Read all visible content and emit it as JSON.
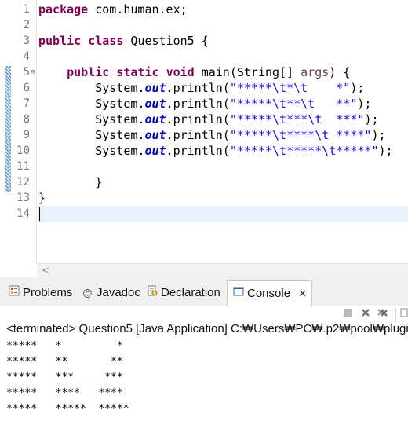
{
  "editor": {
    "line_numbers": [
      "1",
      "2",
      "3",
      "4",
      "5",
      "6",
      "7",
      "8",
      "9",
      "10",
      "11",
      "12",
      "13",
      "14"
    ],
    "fold_marker": "⊖",
    "code": {
      "l1_kw": "package",
      "l1_rest": " com.human.ex;",
      "l3_kw1": "public",
      "l3_kw2": "class",
      "l3_rest": " Question5 {",
      "l5_indent": "    ",
      "l5_kw1": "public",
      "l5_kw2": "static",
      "l5_kw3": "void",
      "l5_mid": " main(String[] ",
      "l5_arg": "args",
      "l5_end": ") {",
      "sys_indent": "        System.",
      "sys_field": "out",
      "sys_call": ".println(",
      "str6": "\"*****\\t*\\t    *\"",
      "str7": "\"*****\\t**\\t   **\"",
      "str8": "\"*****\\t***\\t  ***\"",
      "str9": "\"*****\\t****\\t ****\"",
      "str10": "\"*****\\t*****\\t*****\"",
      "sys_end": ");",
      "l12": "        }",
      "l13": "}"
    },
    "scroll_left_glyph": "<"
  },
  "views": {
    "tabs": [
      {
        "label": "Problems",
        "icon": "problems-icon"
      },
      {
        "label": "Javadoc",
        "icon": "javadoc-icon"
      },
      {
        "label": "Declaration",
        "icon": "declaration-icon"
      },
      {
        "label": "Console",
        "icon": "console-icon"
      }
    ],
    "close_glyph": "✕",
    "status": "<terminated> Question5 [Java Application] C:₩Users₩PC₩.p2₩pool₩plugi",
    "output": [
      "*****   *         *",
      "*****   **       **",
      "*****   ***     ***",
      "*****   ****   ****",
      "*****   *****  *****"
    ]
  }
}
